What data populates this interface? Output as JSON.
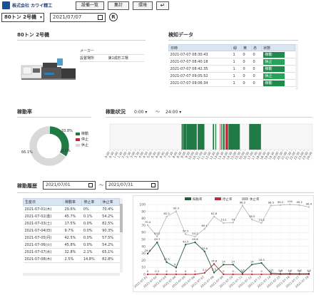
{
  "header": {
    "company": "株式会社 カワイ精工",
    "buttons": {
      "list": "設備一覧",
      "total": "集計",
      "env": "環境",
      "back": "↵"
    },
    "machine": "80トン 2号機",
    "date": "2021/07/07",
    "refresh": "R"
  },
  "machine_panel": {
    "title": "80トン 2号機",
    "rows": [
      {
        "key": "メーカー",
        "value": ""
      },
      {
        "key": "設置場所",
        "value": "第1成形工場"
      }
    ]
  },
  "detection": {
    "title": "検知データ",
    "columns": [
      "日時",
      "緑",
      "黄",
      "赤",
      "状態"
    ],
    "rows": [
      {
        "dt": "2021-07-07 08:30:43",
        "g": "1",
        "y": "0",
        "r": "0",
        "state": "稼動",
        "kind": "run"
      },
      {
        "dt": "2021-07-07 08:40:18",
        "g": "1",
        "y": "0",
        "r": "0",
        "state": "休止",
        "kind": "stop"
      },
      {
        "dt": "2021-07-07 08:42:35",
        "g": "1",
        "y": "0",
        "r": "0",
        "state": "稼動",
        "kind": "run"
      },
      {
        "dt": "2021-07-07 09:05:52",
        "g": "1",
        "y": "0",
        "r": "0",
        "state": "休止",
        "kind": "stop"
      },
      {
        "dt": "2021-07-07 09:06:34",
        "g": "1",
        "y": "0",
        "r": "0",
        "state": "稼動",
        "kind": "run"
      }
    ]
  },
  "rate": {
    "title": "稼動率",
    "run_pct": 33.8,
    "stop_pct": 0.1,
    "idle_pct": 66.1,
    "labels": {
      "run": "33.8%",
      "idle": "66.1%",
      "stop": "0.1%"
    },
    "legend": [
      "稼動",
      "停止",
      "休止"
    ],
    "colors": {
      "run": "#1f7a45",
      "stop": "#c0283c",
      "idle": "#d9d9d9"
    }
  },
  "status": {
    "title": "稼動状況",
    "from": "0:00",
    "to": "24:00",
    "tilde": "〜",
    "axis_ticks": [
      "0:00",
      "0:30",
      "1:00",
      "1:30",
      "2:00",
      "2:30",
      "3:00",
      "3:30",
      "4:00",
      "4:30",
      "5:00",
      "5:30",
      "6:00",
      "6:30",
      "7:00",
      "7:30",
      "8:00",
      "8:30",
      "9:00",
      "9:30",
      "10:00",
      "10:30",
      "11:00",
      "11:30",
      "12:00",
      "12:30",
      "13:00",
      "13:30",
      "14:00",
      "14:30",
      "15:00",
      "15:30",
      "16:00",
      "16:30",
      "17:00",
      "17:30",
      "18:00",
      "18:30",
      "19:00",
      "19:30",
      "20:00",
      "20:30",
      "21:00",
      "21:30",
      "22:00",
      "22:30",
      "23:00",
      "23:30",
      "24:00"
    ],
    "bands": [
      {
        "start": 8.5,
        "end": 8.67,
        "kind": "run"
      },
      {
        "start": 8.7,
        "end": 9.08,
        "kind": "run"
      },
      {
        "start": 9.1,
        "end": 10.3,
        "kind": "run"
      },
      {
        "start": 10.4,
        "end": 11.2,
        "kind": "run"
      },
      {
        "start": 12.2,
        "end": 12.35,
        "kind": "run"
      },
      {
        "start": 12.5,
        "end": 12.6,
        "kind": "run"
      },
      {
        "start": 13.05,
        "end": 13.12,
        "kind": "stop"
      },
      {
        "start": 13.2,
        "end": 13.3,
        "kind": "run"
      },
      {
        "start": 13.4,
        "end": 13.6,
        "kind": "run"
      },
      {
        "start": 13.7,
        "end": 14.0,
        "kind": "stop"
      },
      {
        "start": 14.05,
        "end": 15.4,
        "kind": "run"
      },
      {
        "start": 16.5,
        "end": 17.9,
        "kind": "run"
      }
    ]
  },
  "history": {
    "title": "稼動履歴",
    "from": "2021/07/01",
    "to": "2021/07/31",
    "tilde": "〜",
    "columns": [
      "生産日",
      "稼動率",
      "停止率",
      "休止率"
    ],
    "rows": [
      [
        "2021-07-01(木)",
        "29.6%",
        "0%",
        "70.4%"
      ],
      [
        "2021-07-02(金)",
        "45.7%",
        "0.1%",
        "54.2%"
      ],
      [
        "2021-07-03(土)",
        "17.5%",
        "0.0%",
        "82.5%"
      ],
      [
        "2021-07-04(日)",
        "9.7%",
        "0.0%",
        "90.3%"
      ],
      [
        "2021-07-05(月)",
        "42.5%",
        "0.0%",
        "57.5%"
      ],
      [
        "2021-07-06(火)",
        "45.8%",
        "0.0%",
        "54.2%"
      ],
      [
        "2021-07-07(水)",
        "32.8%",
        "2.1%",
        "65.1%"
      ],
      [
        "2021-07-08(木)",
        "2.5%",
        "14.8%",
        "82.8%"
      ]
    ]
  },
  "chart_data": {
    "type": "line",
    "legend": [
      "稼動率",
      "停止率",
      "休止率"
    ],
    "colors": [
      "#1f5c3a",
      "#c0283c",
      "#bbbbbb"
    ],
    "ylim": [
      0,
      100
    ],
    "yticks": [
      0,
      10,
      20,
      30,
      40,
      50,
      60,
      70,
      80,
      90,
      100
    ],
    "categories": [
      "2021-07-01",
      "2021-07-02",
      "2021-07-03",
      "2021-07-04",
      "2021-07-05",
      "2021-07-06",
      "2021-07-07",
      "2021-07-08",
      "2021-07-09",
      "2021-07-10",
      "2021-07-11",
      "2021-07-12",
      "2021-07-13",
      "2021-07-14",
      "2021-07-15",
      "2021-07-16",
      "2021-07-17",
      "2021-07-18"
    ],
    "series": [
      {
        "name": "稼動率",
        "values": [
          29.6,
          45.7,
          17.5,
          9.7,
          42.5,
          45.8,
          32.8,
          2.5,
          14.0,
          14.0,
          1.5,
          14.0,
          16.3,
          1.5,
          0.8,
          1.0,
          0.8,
          1.0
        ]
      },
      {
        "name": "停止率",
        "values": [
          0,
          0.1,
          0,
          0,
          0,
          0,
          2.1,
          14.8,
          0,
          0,
          0,
          0,
          0,
          0,
          0,
          0,
          0,
          0
        ]
      },
      {
        "name": "休止率",
        "values": [
          70.4,
          54.2,
          82.5,
          90.3,
          57.5,
          54.2,
          65.1,
          82.8,
          73.5,
          74.0,
          98.5,
          78.5,
          73.5,
          98.5,
          99.2,
          100.0,
          99.2,
          96.4
        ]
      }
    ],
    "point_labels": {
      "稼動率": [
        "29.6",
        "45.7",
        "17.5",
        "9.7",
        "42.5",
        "45.8",
        "32.8",
        "2.5",
        "14",
        "14",
        "1.5",
        "14",
        "16.3",
        "1.5",
        "0.8",
        "1.0",
        "0.8",
        "1.0"
      ],
      "停止率": [
        "0",
        "0.1",
        "0",
        "0",
        "0",
        "0",
        "2.1",
        "14.8",
        "0",
        "0",
        "0",
        "0",
        "0",
        "0",
        "0",
        "0",
        "0",
        "0"
      ],
      "休止率": [
        "70.4",
        "54.2",
        "82.5",
        "90.3",
        "57.5",
        "54.2",
        "65.1",
        "82.8",
        "73.5",
        "74",
        "98.5",
        "78.5",
        "73.5",
        "98.5",
        "99.2",
        "100",
        "99.2",
        "96.4"
      ]
    }
  }
}
